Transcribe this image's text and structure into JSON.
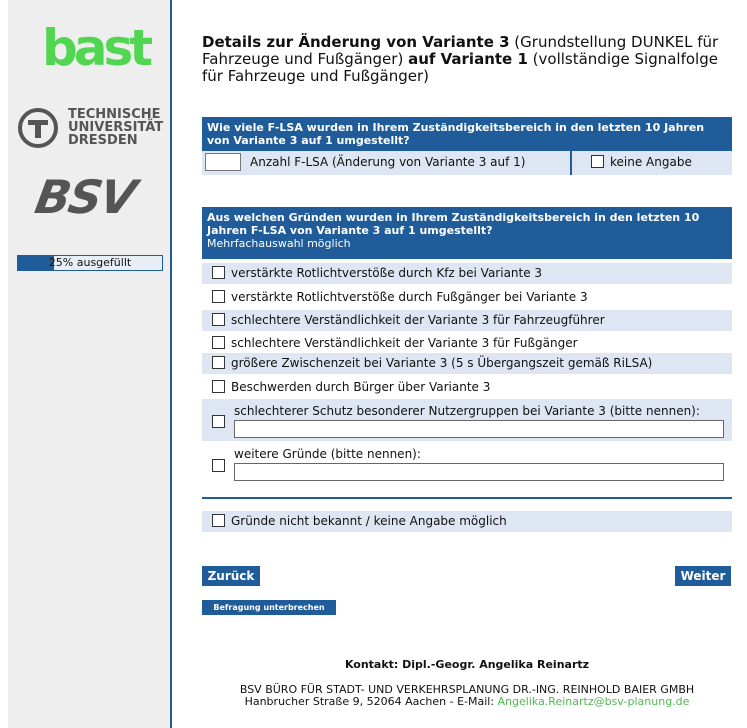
{
  "sidebar": {
    "logo_bast": "bast",
    "logo_tu": "TECHNISCHE UNIVERSITÄT DRESDEN",
    "logo_bsv": "BSV",
    "progress_text": "25% ausgefüllt",
    "progress_value": 0.25
  },
  "title": {
    "part1": "Details zur Änderung von Variante 3",
    "part2": " (Grundstellung DUNKEL für Fahrzeuge und Fußgänger) ",
    "part3": "auf Variante 1",
    "part4": " (vollständige Signalfolge für Fahrzeuge und Fußgänger)"
  },
  "q1": {
    "header": "Wie viele F-LSA wurden in Ihrem Zuständigkeitsbereich in den letzten 10 Jahren von Variante 3 auf 1 umgestellt?",
    "input_label": "Anzahl F-LSA (Änderung von Variante 3 auf 1)",
    "no_answer": "keine Angabe"
  },
  "q2": {
    "header": "Aus welchen Gründen wurden in Ihrem Zuständigkeitsbereich in den letzten 10 Jahren F-LSA von Variante 3 auf 1 umgestellt?",
    "subheader": "Mehrfachauswahl möglich",
    "options": [
      "verstärkte Rotlichtverstöße durch Kfz bei Variante 3",
      "verstärkte Rotlichtverstöße durch Fußgänger bei Variante 3",
      "schlechtere Verständlichkeit der Variante 3 für Fahrzeugführer",
      "schlechtere Verständlichkeit der Variante 3 für Fußgänger",
      "größere Zwischenzeit bei Variante 3 (5 s Übergangszeit gemäß RiLSA)",
      "Beschwerden durch Bürger über Variante 3",
      "schlechterer Schutz besonderer Nutzergruppen bei Variante 3 (bitte nennen):",
      "weitere Gründe (bitte nennen):"
    ],
    "not_known": "Gründe nicht bekannt / keine Angabe möglich"
  },
  "buttons": {
    "back": "Zurück",
    "next": "Weiter",
    "pause": "Befragung unterbrechen"
  },
  "footer": {
    "contact": "Kontakt: Dipl.-Geogr. Angelika Reinartz",
    "company": "BSV BÜRO FÜR STADT- UND VERKEHRSPLANUNG DR.-ING. REINHOLD BAIER GMBH",
    "address": "Hanbrucher Straße 9, 52064 Aachen - E-Mail: ",
    "email": "Angelika.Reinartz@bsv-planung.de"
  },
  "colors": {
    "accent": "#1f5c99",
    "row_alt": "#dde6f2",
    "bast_green": "#52d652",
    "email_green": "#52b852"
  }
}
